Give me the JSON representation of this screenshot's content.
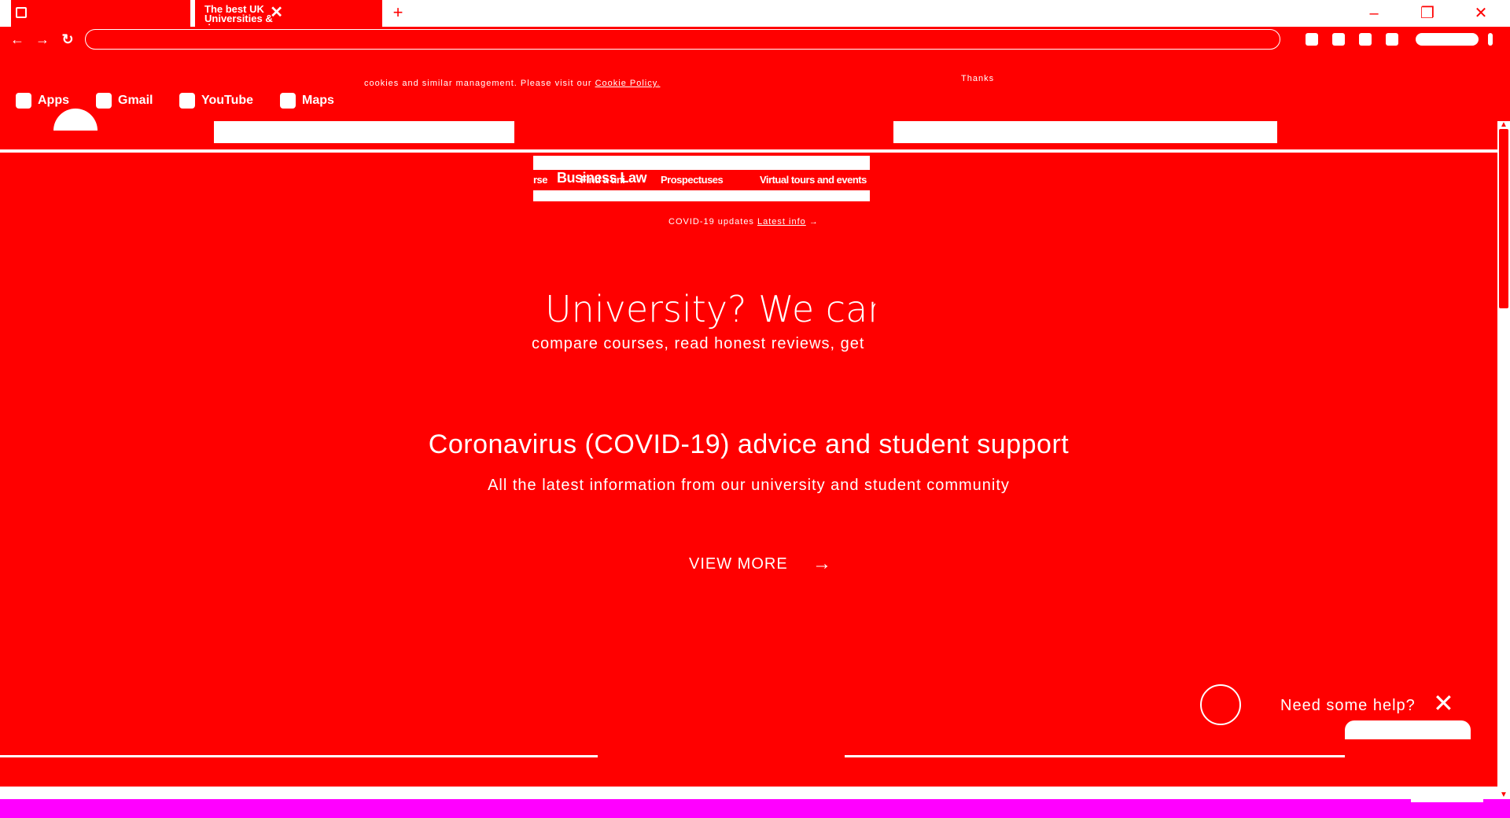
{
  "browser": {
    "tabs": [
      {
        "label": ""
      },
      {
        "label": "The best UK Universities & degree"
      },
      {
        "label": ""
      }
    ],
    "new_tab_label": "+",
    "window_buttons": {
      "minimize": "–",
      "restore": "❐",
      "close": "✕"
    },
    "nav": {
      "back": "←",
      "forward": "→",
      "reload": "↻"
    }
  },
  "bookmarks": [
    {
      "label": "Apps"
    },
    {
      "label": "Gmail"
    },
    {
      "label": "YouTube"
    },
    {
      "label": "Maps"
    }
  ],
  "cookie_banner": {
    "text": "cookies and similar management. Please visit our",
    "link": "Cookie Policy.",
    "right_text": "Thanks"
  },
  "site_nav": {
    "links": [
      "rse",
      "Find a uni",
      "Prospectuses",
      "Virtual tours and events"
    ],
    "feature": "Business Law"
  },
  "updates": {
    "text": "COVID-19 updates",
    "link": "Latest info"
  },
  "hero": {
    "title": "University? We can",
    "subtitle": "compare courses, read honest reviews, get"
  },
  "covid": {
    "title": "Coronavirus (COVID-19) advice and student support",
    "subtitle": "All the latest information from our university and student community",
    "cta": "VIEW MORE",
    "cta_arrow": "→"
  },
  "help_widget": {
    "text": "Need some help?",
    "close": "✕"
  }
}
